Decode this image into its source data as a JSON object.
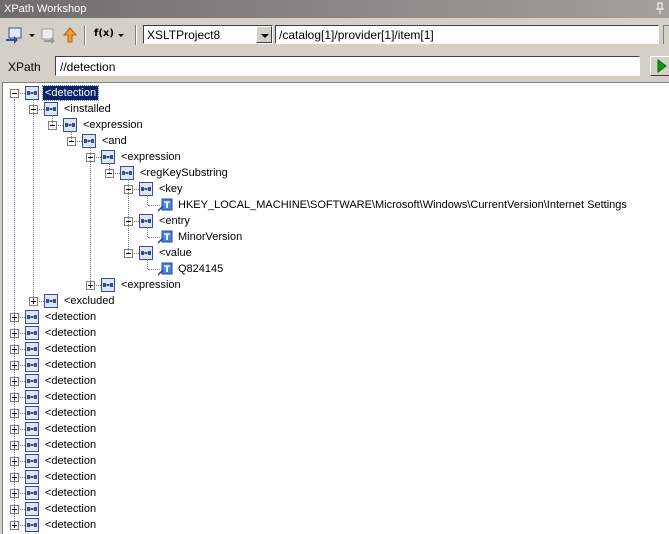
{
  "window": {
    "title": "XPath Workshop"
  },
  "toolbar": {
    "icons": [
      "ns-swap-icon",
      "refresh-icon",
      "up-arrow-icon",
      "function-icon"
    ],
    "function_label": "f(x)",
    "project_select": {
      "value": "XSLTProject8"
    },
    "context_path": "/catalog[1]/provider[1]/item[1]"
  },
  "xpath": {
    "label": "XPath",
    "value": "//detection"
  },
  "tree": [
    {
      "label": "<detection",
      "depth": 0,
      "state": "expanded",
      "selected": true,
      "type": "element"
    },
    {
      "label": "<installed",
      "depth": 1,
      "state": "expanded",
      "type": "element"
    },
    {
      "label": "<expression",
      "depth": 2,
      "state": "expanded",
      "type": "element"
    },
    {
      "label": "<and",
      "depth": 3,
      "state": "expanded",
      "type": "element"
    },
    {
      "label": "<expression",
      "depth": 4,
      "state": "expanded",
      "type": "element"
    },
    {
      "label": "<regKeySubstring",
      "depth": 5,
      "state": "expanded",
      "type": "element"
    },
    {
      "label": "<key",
      "depth": 6,
      "state": "expanded",
      "type": "element"
    },
    {
      "label": "HKEY_LOCAL_MACHINE\\SOFTWARE\\Microsoft\\Windows\\CurrentVersion\\Internet Settings",
      "depth": 7,
      "state": "leaf",
      "type": "text"
    },
    {
      "label": "<entry",
      "depth": 6,
      "state": "expanded",
      "type": "element"
    },
    {
      "label": "MinorVersion",
      "depth": 7,
      "state": "leaf",
      "type": "text"
    },
    {
      "label": "<value",
      "depth": 6,
      "state": "expanded",
      "type": "element"
    },
    {
      "label": "Q824145",
      "depth": 7,
      "state": "leaf",
      "type": "text"
    },
    {
      "label": "<expression",
      "depth": 4,
      "state": "collapsed",
      "type": "element"
    },
    {
      "label": "<excluded",
      "depth": 1,
      "state": "collapsed",
      "type": "element"
    },
    {
      "label": "<detection",
      "depth": 0,
      "state": "collapsed",
      "type": "element"
    },
    {
      "label": "<detection",
      "depth": 0,
      "state": "collapsed",
      "type": "element"
    },
    {
      "label": "<detection",
      "depth": 0,
      "state": "collapsed",
      "type": "element"
    },
    {
      "label": "<detection",
      "depth": 0,
      "state": "collapsed",
      "type": "element"
    },
    {
      "label": "<detection",
      "depth": 0,
      "state": "collapsed",
      "type": "element"
    },
    {
      "label": "<detection",
      "depth": 0,
      "state": "collapsed",
      "type": "element"
    },
    {
      "label": "<detection",
      "depth": 0,
      "state": "collapsed",
      "type": "element"
    },
    {
      "label": "<detection",
      "depth": 0,
      "state": "collapsed",
      "type": "element"
    },
    {
      "label": "<detection",
      "depth": 0,
      "state": "collapsed",
      "type": "element"
    },
    {
      "label": "<detection",
      "depth": 0,
      "state": "collapsed",
      "type": "element"
    },
    {
      "label": "<detection",
      "depth": 0,
      "state": "collapsed",
      "type": "element"
    },
    {
      "label": "<detection",
      "depth": 0,
      "state": "collapsed",
      "type": "element"
    },
    {
      "label": "<detection",
      "depth": 0,
      "state": "collapsed",
      "type": "element"
    },
    {
      "label": "<detection",
      "depth": 0,
      "state": "collapsed",
      "type": "element"
    }
  ],
  "colors": {
    "selection": "#0a246a",
    "chrome": "#d4d0c8",
    "title_bar": "#6f6d6a"
  }
}
